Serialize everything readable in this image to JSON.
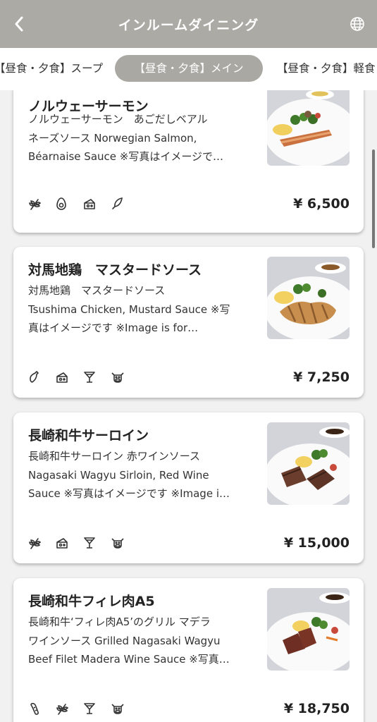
{
  "header": {
    "title": "インルームダイニング",
    "back_icon": "chevron-left-icon",
    "globe_icon": "globe-icon",
    "bg_color": "#abaaa4"
  },
  "tabs": [
    {
      "label": "【昼食・夕食】スープ",
      "selected": false
    },
    {
      "label": "【昼食・夕食】メイン",
      "selected": true
    },
    {
      "label": "【昼食・夕食】軽食",
      "selected": false
    }
  ],
  "items": [
    {
      "name": "ノルウェーサーモン",
      "desc": [
        "ノルウェーサーモン　あごだしベアル",
        "ネーズソース Norwegian Salmon,",
        "Béarnaise Sauce ※写真はイメージで…"
      ],
      "icons": [
        "wheat-icon",
        "egg-icon",
        "cheese-icon",
        "fish-icon"
      ],
      "price": "¥ 6,500"
    },
    {
      "name": "対馬地鶏　マスタードソース",
      "desc": [
        "対馬地鶏　マスタードソース",
        "Tsushima Chicken, Mustard Sauce ※写",
        "真はイメージです ※Image is for…"
      ],
      "icons": [
        "chicken-leg-icon",
        "cheese-icon",
        "cocktail-glass-icon",
        "cow-icon"
      ],
      "price": "¥ 7,250"
    },
    {
      "name": "長崎和牛サーロイン",
      "desc": [
        "長崎和牛サーロイン 赤ワインソース",
        "Nagasaki Wagyu Sirloin, Red Wine",
        "Sauce ※写真はイメージです ※Image i…"
      ],
      "icons": [
        "wheat-icon",
        "cheese-icon",
        "cocktail-glass-icon",
        "cow-icon"
      ],
      "price": "¥ 15,000"
    },
    {
      "name": "長崎和牛フィレ肉A5",
      "desc": [
        "長崎和牛‘フィレ肉A5’のグリル マデラ",
        "ワインソース Grilled Nagasaki Wagyu",
        "Beef Filet Madera Wine Sauce ※写真…"
      ],
      "icons": [
        "sausage-icon",
        "wheat-icon",
        "cocktail-glass-icon",
        "cow-icon"
      ],
      "price": "¥ 18,750"
    }
  ]
}
